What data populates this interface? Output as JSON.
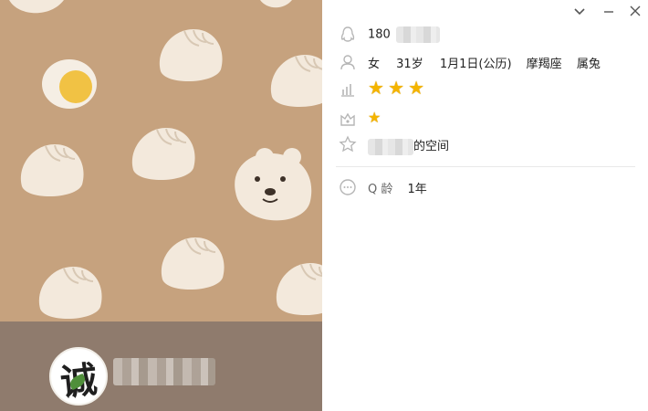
{
  "window": {
    "controls": [
      {
        "name": "collapse-button",
        "glyph": "⌄"
      },
      {
        "name": "minimize-button",
        "glyph": "—"
      },
      {
        "name": "close-button",
        "glyph": "✕"
      }
    ]
  },
  "profile": {
    "qq_number_prefix": "180",
    "gender": "女",
    "age": "31岁",
    "birthday": "1月1日(公历)",
    "zodiac": "摩羯座",
    "chinese_zodiac": "属兔",
    "level_stars": 3,
    "vip_stars": 1,
    "space_suffix": "的空间",
    "q_age_label": "Q 龄",
    "q_age_value": "1年"
  },
  "avatar": {
    "glyph": "诚"
  },
  "colors": {
    "pattern_bg": "#c6a27e",
    "footer_bg": "#8f7b6d",
    "star": "#f4b400",
    "icon_gray": "#b5b5b5"
  },
  "icons": [
    "qq-penguin-icon",
    "person-icon",
    "level-chart-icon",
    "crown-house-icon",
    "qzone-star-icon",
    "more-circle-icon"
  ]
}
